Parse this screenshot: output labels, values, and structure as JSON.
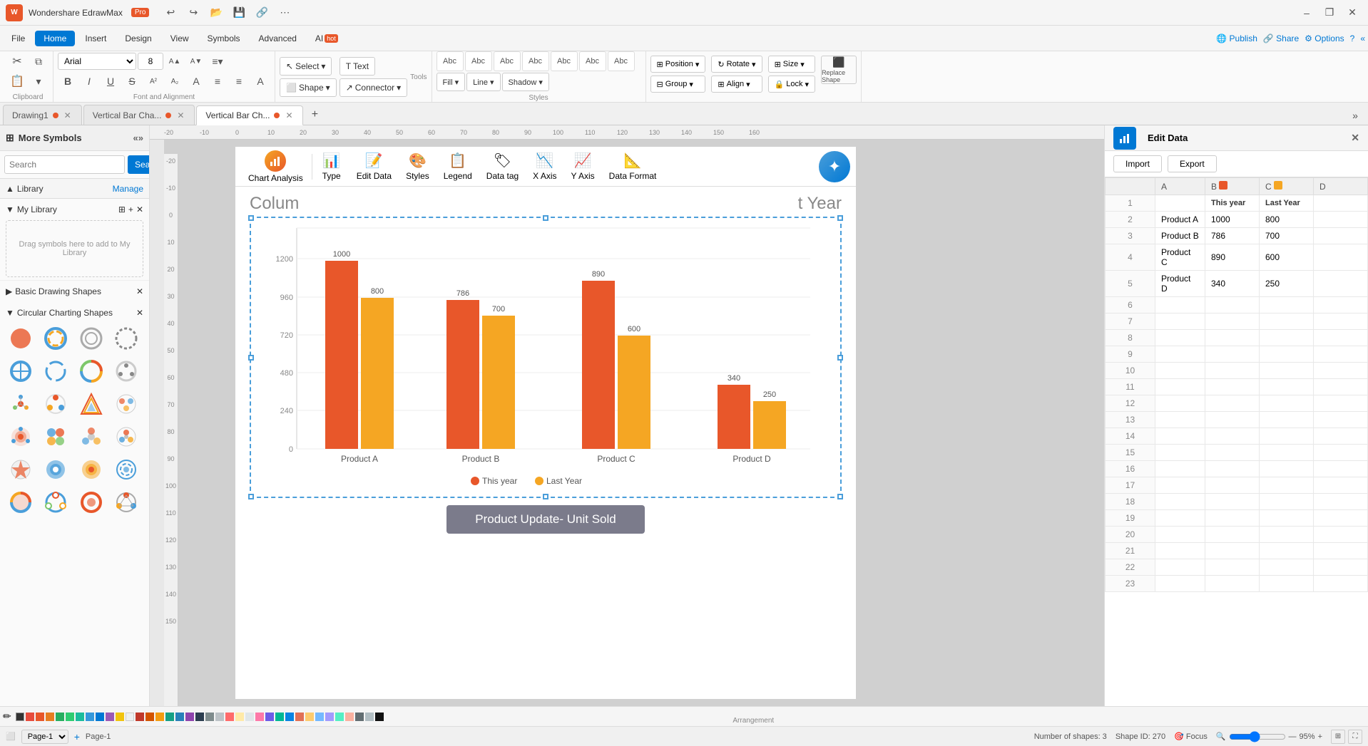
{
  "app": {
    "name": "Wondershare EdrawMax",
    "tier": "Pro",
    "window_controls": [
      "minimize",
      "restore",
      "close"
    ]
  },
  "titlebar": {
    "undo": "↩",
    "redo": "↪",
    "open": "📂",
    "save": "💾",
    "share_save": "🔗",
    "more": "⋯",
    "minimize": "–",
    "restore": "❐",
    "close": "✕"
  },
  "menubar": {
    "items": [
      "File",
      "Home",
      "Insert",
      "Design",
      "View",
      "Symbols",
      "Advanced"
    ],
    "ai_label": "AI",
    "ai_hot": "hot",
    "active": "Home",
    "publish": "Publish",
    "share": "Share",
    "options": "Options",
    "help": "?",
    "collapse": "«"
  },
  "toolbar": {
    "clipboard": {
      "label": "Clipboard",
      "cut": "✂",
      "copy": "⧉",
      "paste": "📋",
      "paste_special": "▾"
    },
    "font": {
      "label": "Font and Alignment",
      "family": "Arial",
      "size": "8",
      "bold": "B",
      "italic": "I",
      "underline": "U",
      "strikethrough": "S",
      "superscript": "A²",
      "subscript": "A₂",
      "text_format": "A",
      "bullets": "≡",
      "align": "≡",
      "font_color": "A",
      "expand": "⤢"
    },
    "tools": {
      "label": "Tools",
      "select": "Select",
      "select_icon": "↖",
      "shape": "Shape",
      "shape_icon": "⬜",
      "text": "Text",
      "text_icon": "T",
      "connector": "Connector",
      "connector_icon": "↗"
    },
    "styles": {
      "label": "Styles",
      "swatches": [
        "Abc",
        "Abc",
        "Abc",
        "Abc",
        "Abc",
        "Abc",
        "Abc"
      ],
      "fill": "Fill ▾",
      "line": "Line ▾",
      "shadow": "Shadow ▾",
      "expand": "⤢"
    },
    "arrangement": {
      "label": "Arrangement",
      "position": "Position",
      "group": "Group",
      "rotate": "Rotate",
      "align": "Align",
      "size": "Size",
      "lock": "Lock",
      "replace_label": "Replace Shape",
      "replace": "Replace"
    }
  },
  "tabs": [
    {
      "label": "Drawing1",
      "active": false,
      "dirty": true,
      "closable": true
    },
    {
      "label": "Vertical Bar Cha...",
      "active": false,
      "dirty": true,
      "closable": true
    },
    {
      "label": "Vertical Bar Ch...",
      "active": true,
      "dirty": true,
      "closable": true
    }
  ],
  "left_panel": {
    "title": "More Symbols",
    "search_placeholder": "Search",
    "search_btn": "Search",
    "library_label": "Library",
    "manage_label": "Manage",
    "my_library": "My Library",
    "my_library_drop": "Drag symbols here to add to My Library",
    "basic_shapes": "Basic Drawing Shapes",
    "circular_shapes": "Circular Charting Shapes"
  },
  "chart_toolbar": {
    "analysis_label": "Chart Analysis",
    "type_label": "Type",
    "edit_data_label": "Edit Data",
    "styles_label": "Styles",
    "legend_label": "Legend",
    "data_tag_label": "Data tag",
    "x_axis_label": "X Axis",
    "y_axis_label": "Y Axis",
    "data_format_label": "Data Format"
  },
  "chart": {
    "title": "Colum",
    "subtitle": "t Year",
    "banner_text": "Product Update- Unit Sold",
    "x_labels": [
      "Product A",
      "Product B",
      "Product C",
      "Product D"
    ],
    "y_axis": [
      0,
      240,
      480,
      720,
      960,
      1200
    ],
    "legend": [
      {
        "label": "This year",
        "color": "#e8572a"
      },
      {
        "label": "Last Year",
        "color": "#f5a623"
      }
    ],
    "series": {
      "this_year": [
        1000,
        786,
        890,
        340
      ],
      "last_year": [
        800,
        700,
        600,
        250
      ]
    }
  },
  "edit_data": {
    "title": "Edit Data",
    "import_btn": "Import",
    "export_btn": "Export",
    "columns": {
      "A": "",
      "B": "This year",
      "C": "Last Year",
      "D": ""
    },
    "rows": [
      {
        "num": 1,
        "a": "",
        "b": "",
        "c": "",
        "d": ""
      },
      {
        "num": 2,
        "a": "Product A",
        "b": "1000",
        "c": "800",
        "d": ""
      },
      {
        "num": 3,
        "a": "Product B",
        "b": "786",
        "c": "700",
        "d": ""
      },
      {
        "num": 4,
        "a": "Product C",
        "b": "890",
        "c": "600",
        "d": ""
      },
      {
        "num": 5,
        "a": "Product D",
        "b": "340",
        "c": "250",
        "d": ""
      },
      {
        "num": 6,
        "a": "",
        "b": "",
        "c": "",
        "d": ""
      },
      {
        "num": 7,
        "a": "",
        "b": "",
        "c": "",
        "d": ""
      },
      {
        "num": 8,
        "a": "",
        "b": "",
        "c": "",
        "d": ""
      },
      {
        "num": 9,
        "a": "",
        "b": "",
        "c": "",
        "d": ""
      },
      {
        "num": 10,
        "a": "",
        "b": "",
        "c": "",
        "d": ""
      },
      {
        "num": 11,
        "a": "",
        "b": "",
        "c": "",
        "d": ""
      },
      {
        "num": 12,
        "a": "",
        "b": "",
        "c": "",
        "d": ""
      },
      {
        "num": 13,
        "a": "",
        "b": "",
        "c": "",
        "d": ""
      },
      {
        "num": 14,
        "a": "",
        "b": "",
        "c": "",
        "d": ""
      },
      {
        "num": 15,
        "a": "",
        "b": "",
        "c": "",
        "d": ""
      },
      {
        "num": 16,
        "a": "",
        "b": "",
        "c": "",
        "d": ""
      },
      {
        "num": 17,
        "a": "",
        "b": "",
        "c": "",
        "d": ""
      },
      {
        "num": 18,
        "a": "",
        "b": "",
        "c": "",
        "d": ""
      },
      {
        "num": 19,
        "a": "",
        "b": "",
        "c": "",
        "d": ""
      },
      {
        "num": 20,
        "a": "",
        "b": "",
        "c": "",
        "d": ""
      },
      {
        "num": 21,
        "a": "",
        "b": "",
        "c": "",
        "d": ""
      },
      {
        "num": 22,
        "a": "",
        "b": "",
        "c": "",
        "d": ""
      },
      {
        "num": 23,
        "a": "",
        "b": "",
        "c": "",
        "d": ""
      }
    ]
  },
  "statusbar": {
    "page_label": "Page-1",
    "shapes_count": "Number of shapes: 3",
    "shape_id": "Shape ID: 270",
    "focus_label": "Focus",
    "zoom_level": "95%",
    "add_page": "+"
  },
  "colors": {
    "accent": "#0078d4",
    "brand": "#e8572a",
    "bar_red": "#e8572a",
    "bar_yellow": "#f5a623"
  }
}
